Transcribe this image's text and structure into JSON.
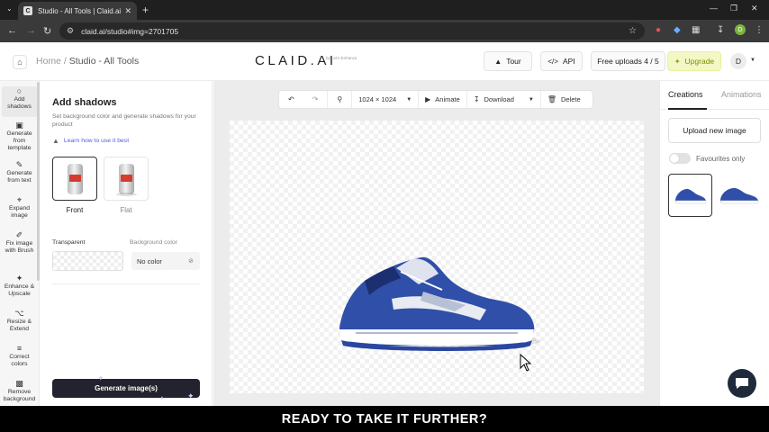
{
  "browser": {
    "tab_title": "Studio - All Tools | Claid.ai",
    "tab_favicon": "C",
    "url": "claid.ai/studio#img=2701705",
    "profile_initial": "D"
  },
  "header": {
    "breadcrumb_home": "Home",
    "breadcrumb_sep": " / ",
    "breadcrumb_current": "Studio - All Tools",
    "logo": "CLAID.AI",
    "logo_sub": "by Let's Enhance",
    "tour_label": "Tour",
    "api_label": "API",
    "uploads_label": "Free uploads 4 / 5",
    "upgrade_label": "Upgrade",
    "avatar_initial": "D"
  },
  "sidebar": {
    "items": [
      {
        "label": "Add shadows"
      },
      {
        "label": "Generate from template"
      },
      {
        "label": "Generate from text"
      },
      {
        "label": "Expand image"
      },
      {
        "label": "Fix image with Brush"
      },
      {
        "label": "Enhance & Upscale"
      },
      {
        "label": "Resize & Extend"
      },
      {
        "label": "Correct colors"
      },
      {
        "label": "Remove background"
      }
    ]
  },
  "panel": {
    "title": "Add shadows",
    "description": "Set background color and generate shadows for your product",
    "learn_link": "Learn how to use it best",
    "options": [
      {
        "label": "Front"
      },
      {
        "label": "Flat"
      }
    ],
    "transparent_label": "Transparent",
    "background_label": "Background color",
    "no_color_label": "No color",
    "generate_label": "Generate image(s)"
  },
  "toolbar": {
    "size_label": "1024 × 1024",
    "animate_label": "Animate",
    "download_label": "Download",
    "delete_label": "Delete"
  },
  "right_panel": {
    "tab_creations": "Creations",
    "tab_animations": "Animations",
    "upload_label": "Upload new image",
    "favourites_label": "Favourites only"
  },
  "caption": "READY TO TAKE IT FURTHER?",
  "colors": {
    "accent": "#22232e",
    "upgrade_bg": "#f3f7c3",
    "link": "#5a5ad6",
    "shoe_blue": "#2f4fa8"
  }
}
